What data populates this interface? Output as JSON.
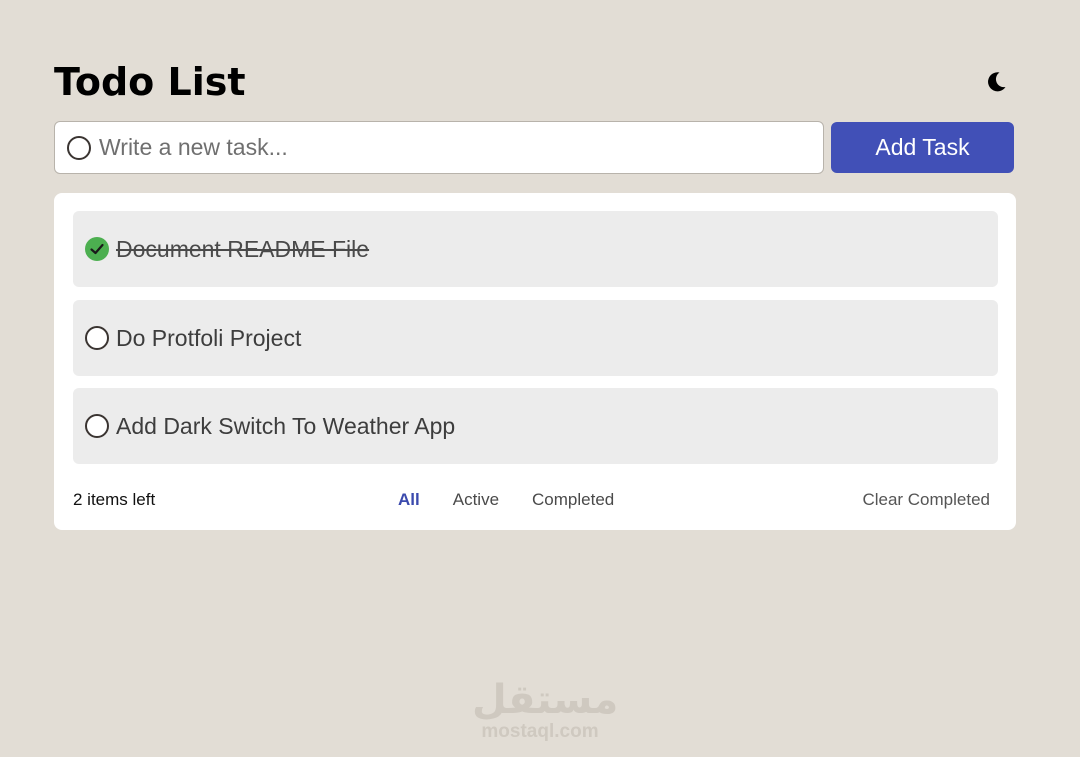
{
  "header": {
    "title": "Todo List"
  },
  "new_task": {
    "placeholder": "Write a new task..."
  },
  "add_button": {
    "label": "Add Task"
  },
  "todos": [
    {
      "label": "Document README File",
      "completed": true
    },
    {
      "label": "Do Protfoli Project",
      "completed": false
    },
    {
      "label": "Add Dark Switch To Weather App",
      "completed": false
    }
  ],
  "footer": {
    "items_left": "2 items left",
    "filters": [
      {
        "label": "All",
        "active": true
      },
      {
        "label": "Active",
        "active": false
      },
      {
        "label": "Completed",
        "active": false
      }
    ],
    "clear_label": "Clear Completed"
  },
  "watermark": {
    "logo": "مستقل",
    "url": "mostaql.com"
  },
  "colors": {
    "background": "#e2ddd5",
    "accent": "#4150b7",
    "check": "#4caf50",
    "active_filter": "#3b4aad"
  },
  "icons": {
    "theme_toggle": "moon-icon",
    "completed": "check-circle-icon",
    "pending": "circle-icon"
  }
}
